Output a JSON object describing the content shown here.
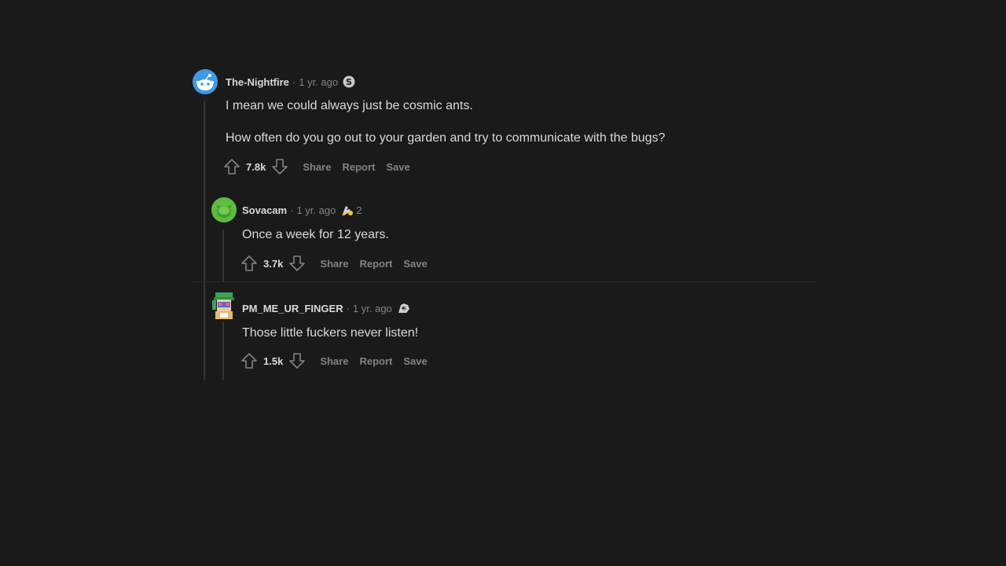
{
  "comments": [
    {
      "username": "The-Nightfire",
      "separator": "·",
      "time": "1 yr. ago",
      "award_icon": "silver-s-award-icon",
      "award_count": "",
      "paragraphs": [
        "I mean we could always just be cosmic ants.",
        "How often do you go out to your garden and try to communicate with the bugs?"
      ],
      "score": "7.8k",
      "actions": [
        "Share",
        "Report",
        "Save"
      ]
    },
    {
      "username": "Sovacam",
      "separator": "·",
      "time": "1 yr. ago",
      "award_icon": "rocket-like-award-icon",
      "award_count": "2",
      "paragraphs": [
        "Once a week for 12 years."
      ],
      "score": "3.7k",
      "actions": [
        "Share",
        "Report",
        "Save"
      ]
    },
    {
      "username": "PM_ME_UR_FINGER",
      "separator": "·",
      "time": "1 yr. ago",
      "award_icon": "helpful-award-icon",
      "award_count": "",
      "paragraphs": [
        "Those little fuckers never listen!"
      ],
      "score": "1.5k",
      "actions": [
        "Share",
        "Report",
        "Save"
      ]
    }
  ],
  "colors": {
    "background": "#1a1a1b",
    "text": "#d7dadc",
    "muted": "#818384",
    "thread_line": "#343536",
    "avatar1_blue": "#3e9be5",
    "avatar2_green": "#5dbb3f"
  }
}
